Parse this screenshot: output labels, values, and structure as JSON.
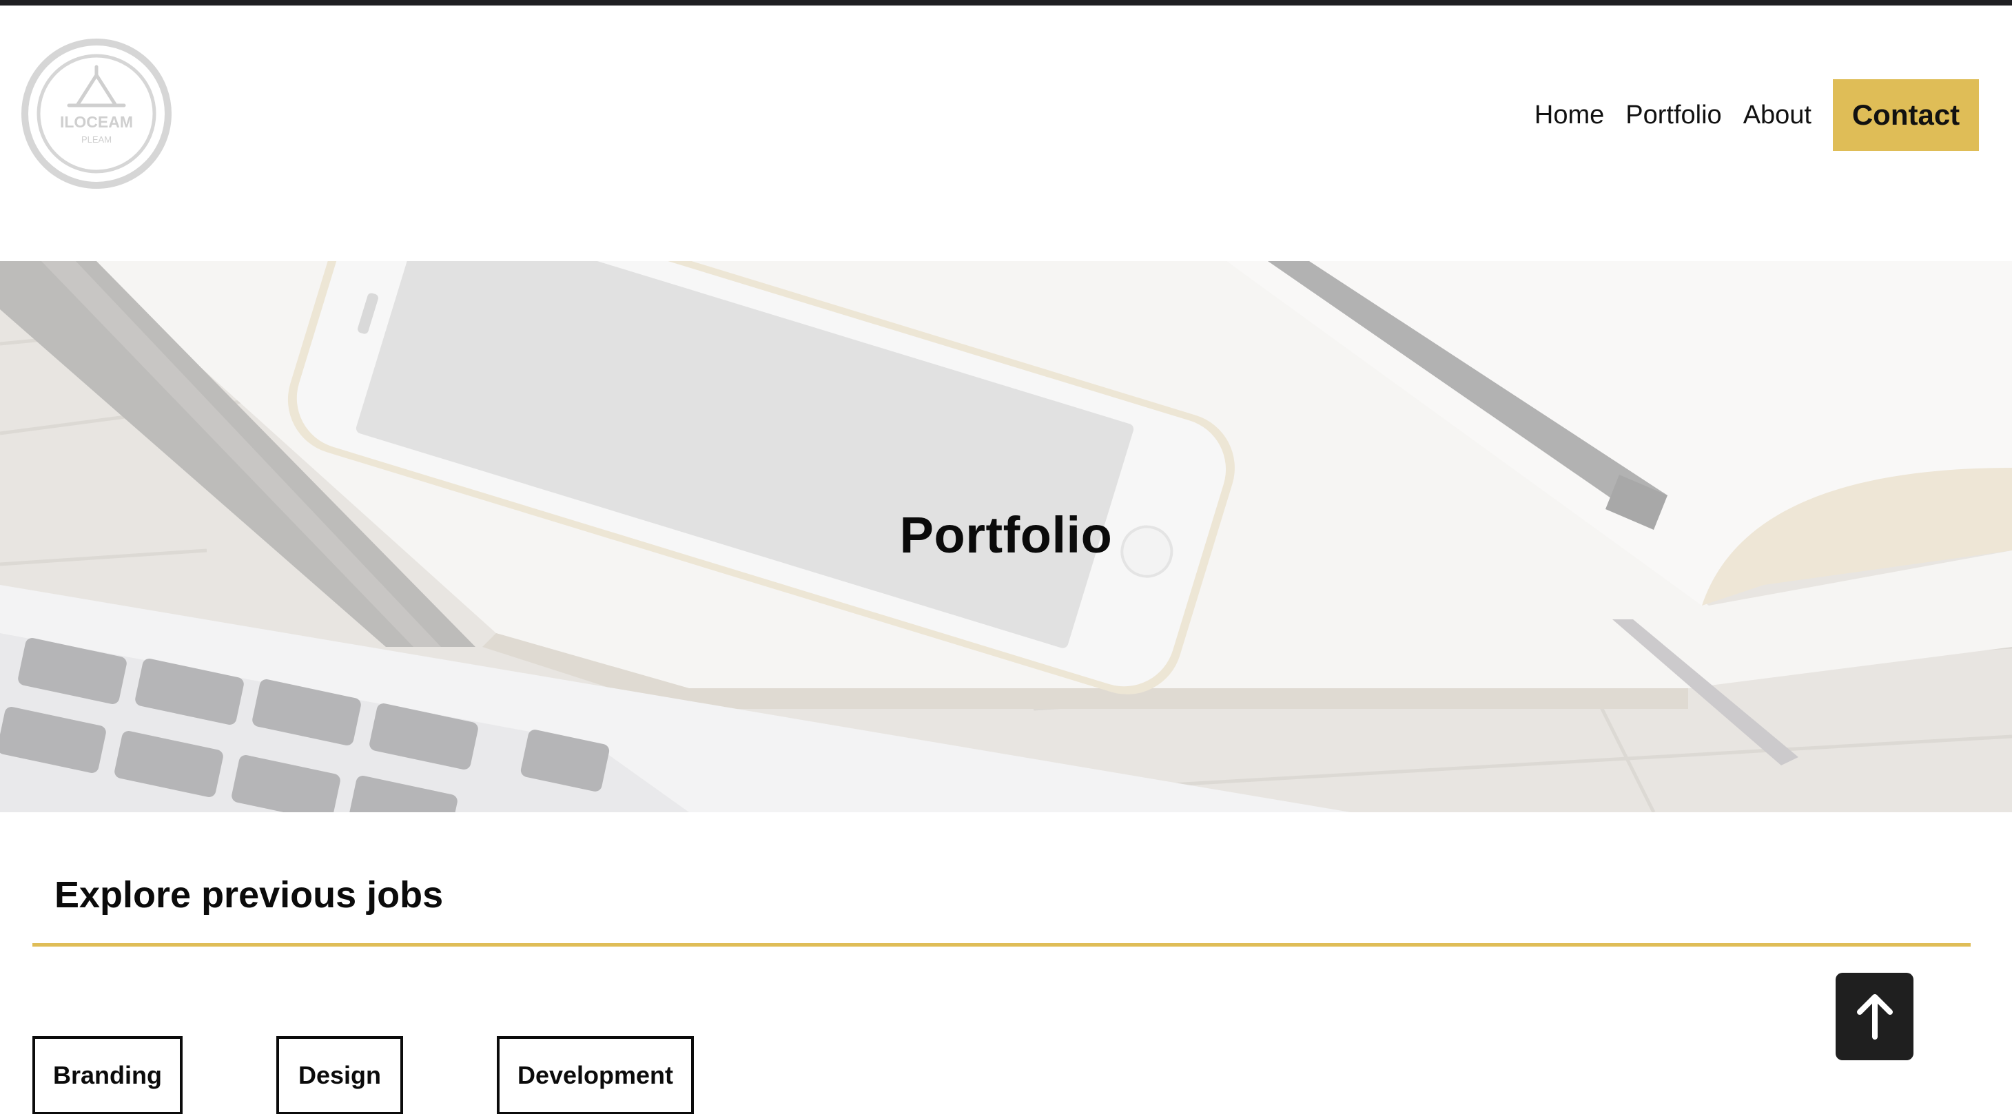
{
  "logo": {
    "text_main": "ILOCEAM",
    "text_sub": "PLEAM"
  },
  "nav": {
    "items": [
      "Home",
      "Portfolio",
      "About"
    ],
    "contact_label": "Contact"
  },
  "hero": {
    "title": "Portfolio"
  },
  "section": {
    "title": "Explore previous jobs",
    "filters": [
      "Branding",
      "Design",
      "Development"
    ]
  },
  "colors": {
    "accent": "#dfbd57",
    "dark": "#1f1f1f"
  },
  "icons": {
    "back_to_top": "arrow-up-icon"
  }
}
